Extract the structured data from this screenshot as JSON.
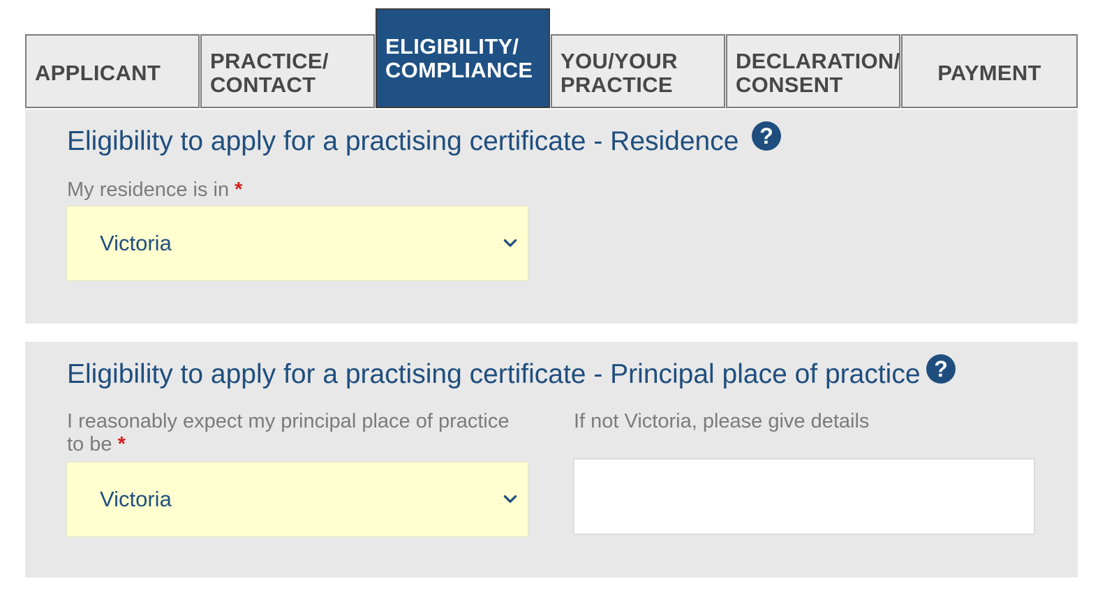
{
  "tabs": [
    {
      "label": "APPLICANT",
      "active": false
    },
    {
      "label": "PRACTICE/\nCONTACT",
      "active": false
    },
    {
      "label": "ELIGIBILITY/\nCOMPLIANCE",
      "active": true
    },
    {
      "label": "YOU/YOUR\nPRACTICE",
      "active": false
    },
    {
      "label": "DECLARATION/\nCONSENT",
      "active": false
    },
    {
      "label": "PAYMENT",
      "active": false
    }
  ],
  "residence": {
    "title": "Eligibility to apply for a practising certificate - Residence",
    "help_glyph": "?",
    "field_label": "My residence is in",
    "required_mark": "*",
    "selected_value": "Victoria"
  },
  "practice": {
    "title": "Eligibility to apply for a practising certificate - Principal place of practice",
    "help_glyph": "?",
    "field_label_line1": "I reasonably expect my principal place of practice",
    "field_label_line2": "to be",
    "required_mark": "*",
    "selected_value": "Victoria",
    "details_label": "If not Victoria, please give details",
    "details_value": ""
  },
  "colors": {
    "brand_blue": "#1f4e7e",
    "active_tab": "#1f5184",
    "panel_bg": "#e8e8e8",
    "select_bg": "#ffffcf",
    "required_red": "#d42020"
  },
  "icons": {
    "help": "question-circle-icon",
    "dropdown": "chevron-down-icon"
  }
}
